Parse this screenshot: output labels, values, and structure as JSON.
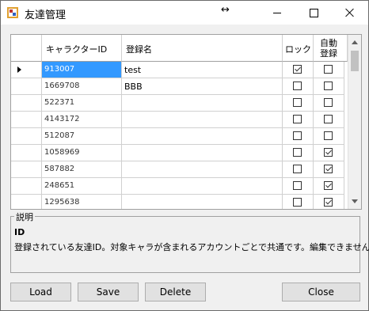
{
  "window": {
    "title": "友達管理",
    "resize_glyph": "↔"
  },
  "grid": {
    "columns": {
      "id": "キャラクターID",
      "name": "登録名",
      "lock": "ロック",
      "auto_line1": "自動",
      "auto_line2": "登録"
    },
    "rows": [
      {
        "id": "913007",
        "name": "test",
        "lock": true,
        "auto": false
      },
      {
        "id": "1669708",
        "name": "BBB",
        "lock": false,
        "auto": false
      },
      {
        "id": "522371",
        "name": "",
        "lock": false,
        "auto": false
      },
      {
        "id": "4143172",
        "name": "",
        "lock": false,
        "auto": false
      },
      {
        "id": "512087",
        "name": "",
        "lock": false,
        "auto": false
      },
      {
        "id": "1058969",
        "name": "",
        "lock": false,
        "auto": true
      },
      {
        "id": "587882",
        "name": "",
        "lock": false,
        "auto": true
      },
      {
        "id": "248651",
        "name": "",
        "lock": false,
        "auto": true
      },
      {
        "id": "1295638",
        "name": "",
        "lock": false,
        "auto": true
      }
    ]
  },
  "description": {
    "title": "説明",
    "field_name": "ID",
    "text": "登録されている友達ID。対象キャラが含まれるアカウントごとで共通です。編集できません。"
  },
  "buttons": {
    "load": "Load",
    "save": "Save",
    "delete": "Delete",
    "close": "Close"
  }
}
